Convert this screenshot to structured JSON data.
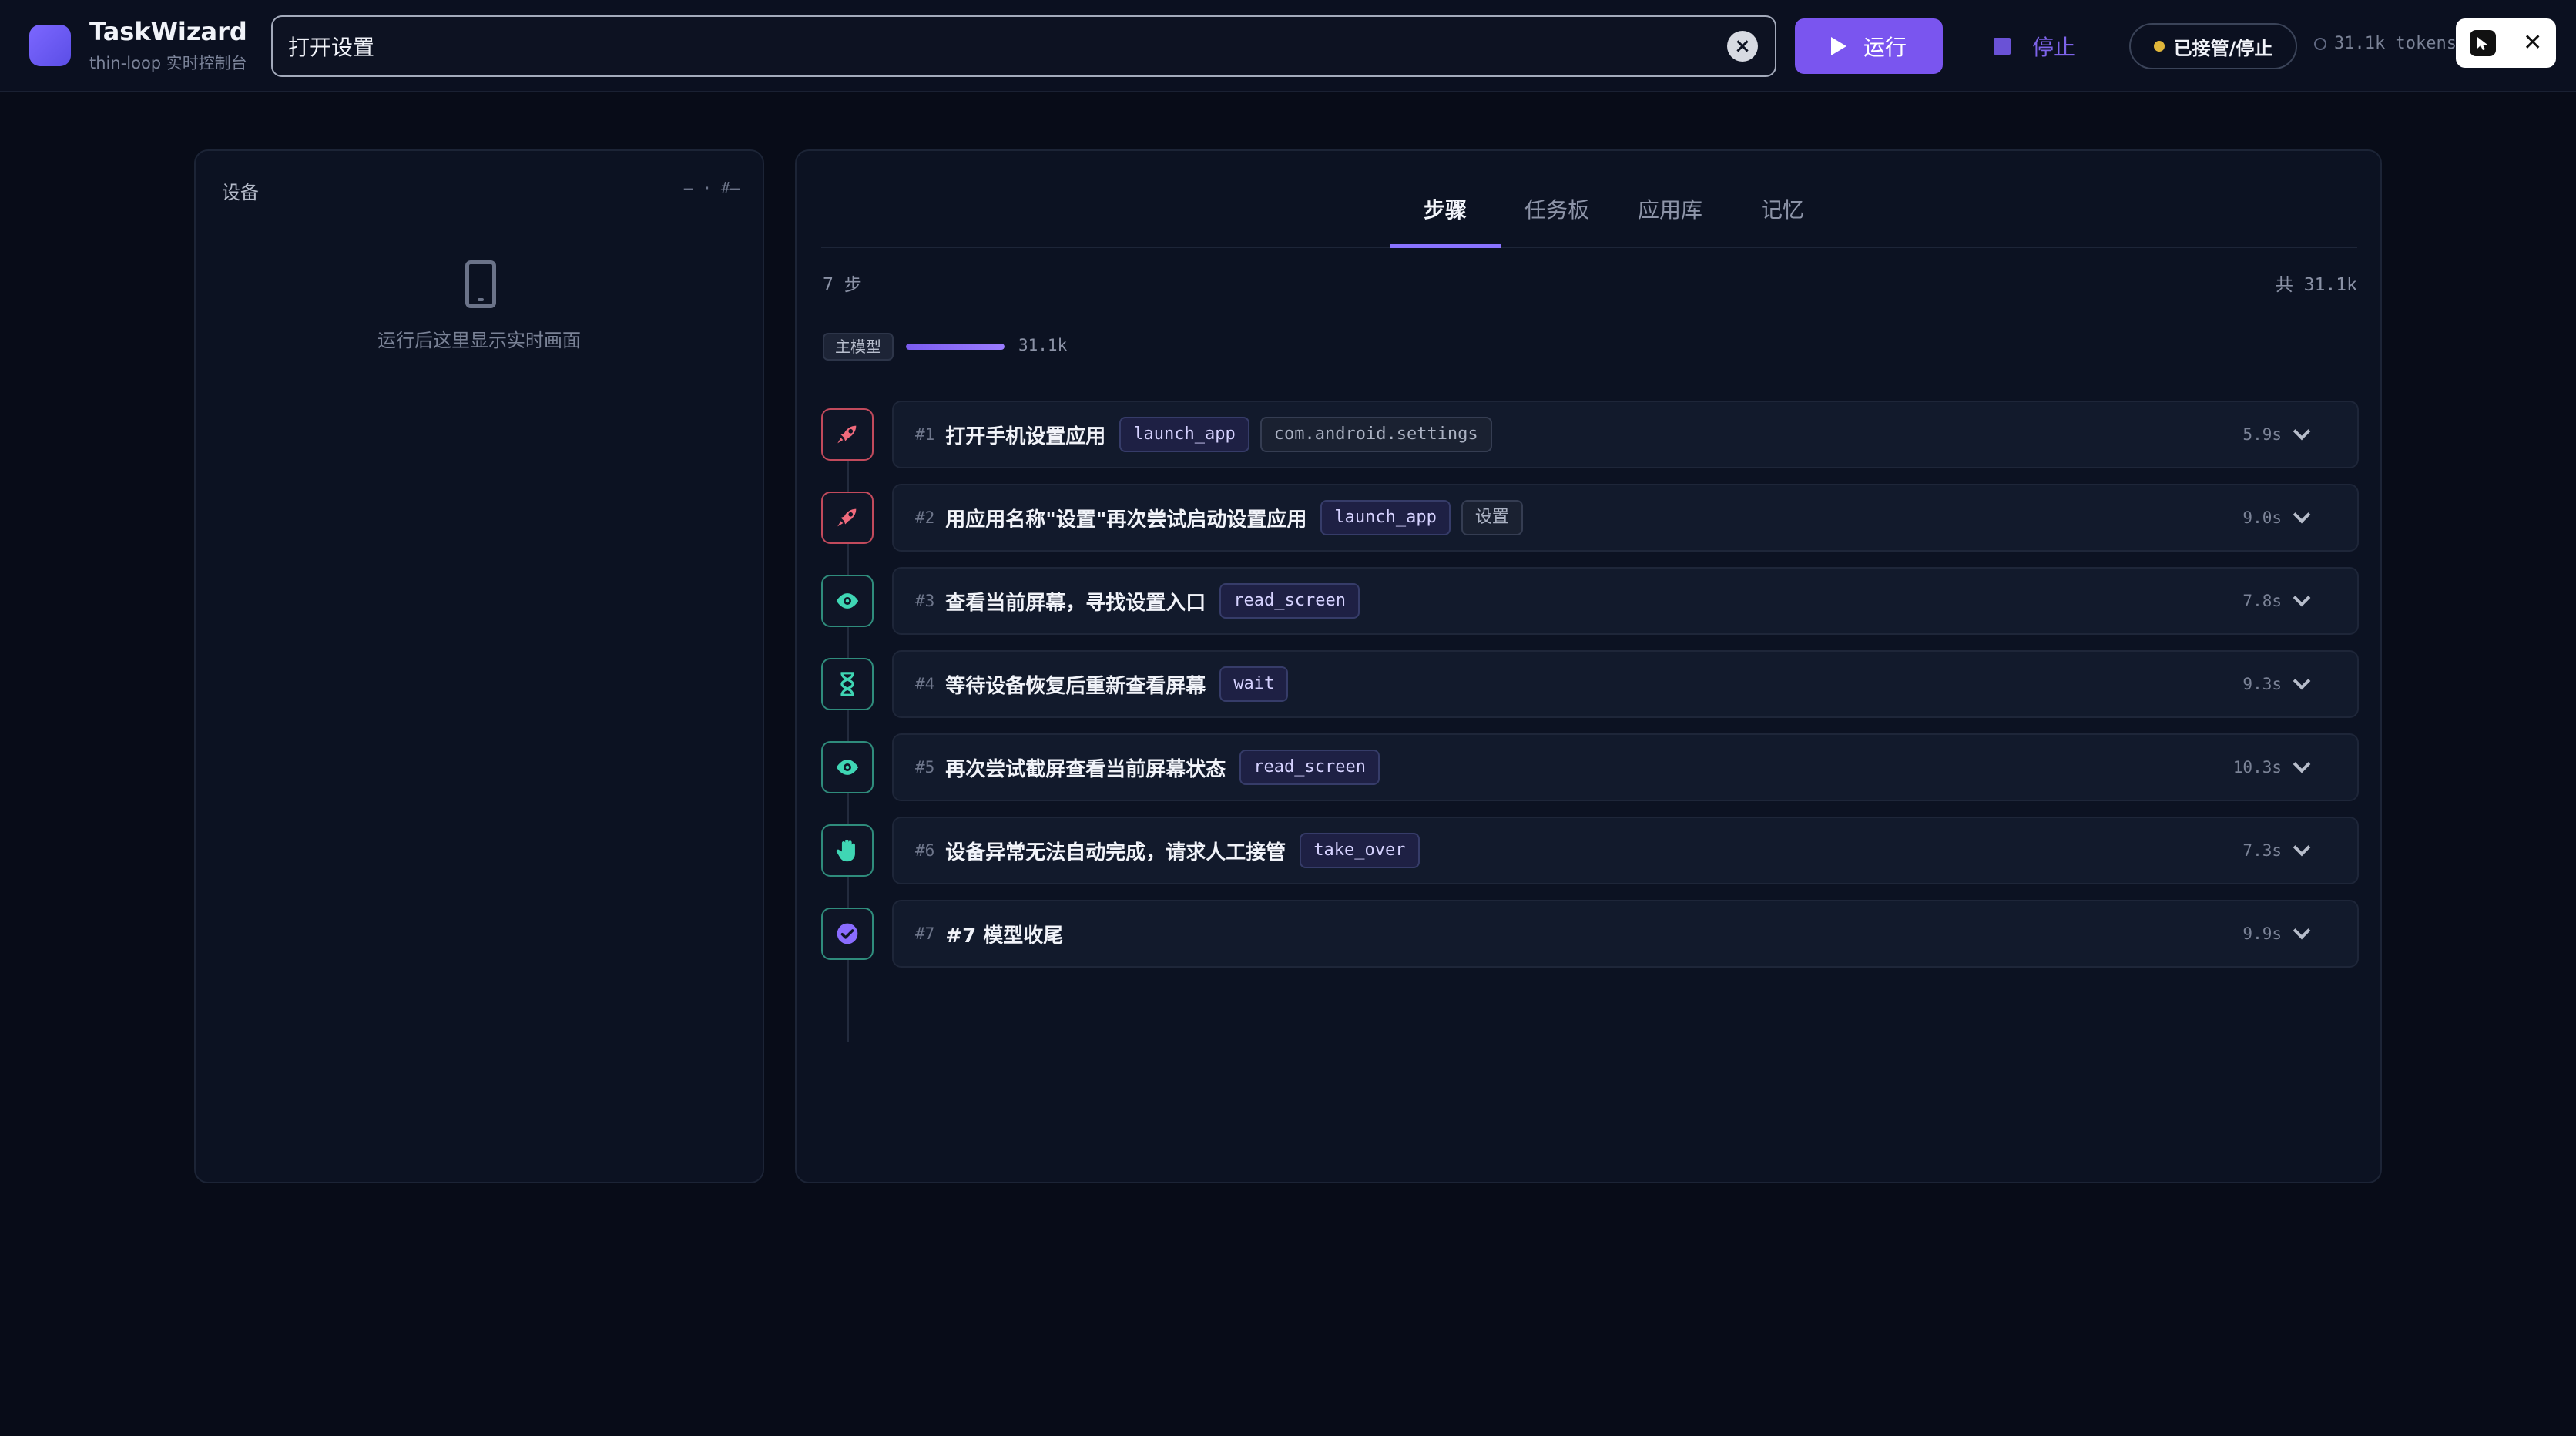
{
  "app": {
    "title": "TaskWizard",
    "subtitle": "thin-loop 实时控制台"
  },
  "search": {
    "value": "打开设置",
    "placeholder": ""
  },
  "toolbar": {
    "run_label": "运行",
    "stop_label": "停止",
    "takeover_label": "已接管/停止",
    "token_readout": "31.1k tokens"
  },
  "device": {
    "title": "设备",
    "meta": "— · #—",
    "placeholder": "运行后这里显示实时画面"
  },
  "tabs": [
    {
      "label": "步骤",
      "active": true
    },
    {
      "label": "任务板",
      "active": false
    },
    {
      "label": "应用库",
      "active": false
    },
    {
      "label": "记忆",
      "active": false
    }
  ],
  "summary": {
    "step_count": "7 步",
    "total": "共 31.1k"
  },
  "model": {
    "badge": "主模型",
    "tokens": "31.1k",
    "usage_fraction": 1.0
  },
  "steps": [
    {
      "num": "#1",
      "title": "打开手机设置应用",
      "tool": "launch_app",
      "arg": "com.android.settings",
      "duration": "5.9s",
      "icon": "rocket-icon"
    },
    {
      "num": "#2",
      "title": "用应用名称\"设置\"再次尝试启动设置应用",
      "tool": "launch_app",
      "arg": "设置",
      "duration": "9.0s",
      "icon": "rocket-icon"
    },
    {
      "num": "#3",
      "title": "查看当前屏幕，寻找设置入口",
      "tool": "read_screen",
      "arg": "",
      "duration": "7.8s",
      "icon": "eye-icon"
    },
    {
      "num": "#4",
      "title": "等待设备恢复后重新查看屏幕",
      "tool": "wait",
      "arg": "",
      "duration": "9.3s",
      "icon": "hourglass-icon"
    },
    {
      "num": "#5",
      "title": "再次尝试截屏查看当前屏幕状态",
      "tool": "read_screen",
      "arg": "",
      "duration": "10.3s",
      "icon": "eye-icon"
    },
    {
      "num": "#6",
      "title": "设备异常无法自动完成，请求人工接管",
      "tool": "take_over",
      "arg": "",
      "duration": "7.3s",
      "icon": "hand-icon"
    },
    {
      "num": "#7",
      "title": "#7 模型收尾",
      "tool": "",
      "arg": "",
      "duration": "9.9s",
      "icon": "check-circle-icon"
    }
  ],
  "colors": {
    "accent": "#7a55ef",
    "background": "#080c18",
    "panel": "#0c1222",
    "launch_border": "#c24a5c",
    "teal_border": "#2f8c7c",
    "status_dot": "#e0b63a"
  }
}
